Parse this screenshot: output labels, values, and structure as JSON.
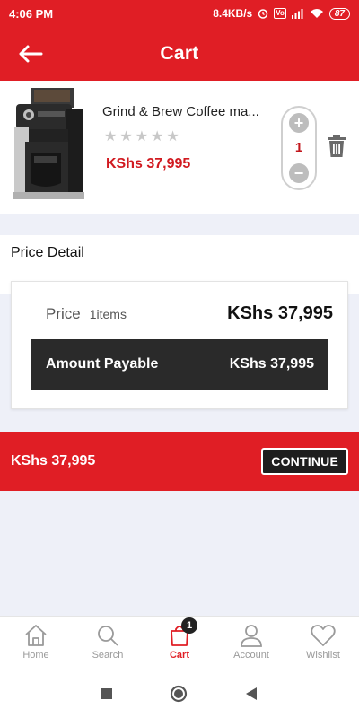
{
  "status_bar": {
    "time": "4:06 PM",
    "network_speed": "8.4KB/s",
    "volte_label": "Vo",
    "battery": "87"
  },
  "header": {
    "title": "Cart",
    "back_icon": "arrow-left-icon"
  },
  "cart_items": [
    {
      "name": "Grind & Brew Coffee ma...",
      "rating_stars": 5,
      "rating_filled": 0,
      "price": "KShs 37,995",
      "quantity": "1"
    }
  ],
  "price_detail": {
    "title": "Price Detail",
    "price_label": "Price",
    "items_count": "1items",
    "price_value": "KShs 37,995",
    "payable_label": "Amount Payable",
    "payable_value": "KShs 37,995"
  },
  "checkout": {
    "total": "KShs 37,995",
    "continue_label": "CONTINUE"
  },
  "bottom_nav": [
    {
      "label": "Home",
      "icon": "home-icon",
      "active": false
    },
    {
      "label": "Search",
      "icon": "search-icon",
      "active": false
    },
    {
      "label": "Cart",
      "icon": "cart-bag-icon",
      "active": true,
      "badge": "1"
    },
    {
      "label": "Account",
      "icon": "user-icon",
      "active": false
    },
    {
      "label": "Wishlist",
      "icon": "heart-icon",
      "active": false
    }
  ],
  "colors": {
    "brand_red": "#e01e25",
    "price_red": "#d11a20",
    "dark": "#2a2a2a"
  }
}
